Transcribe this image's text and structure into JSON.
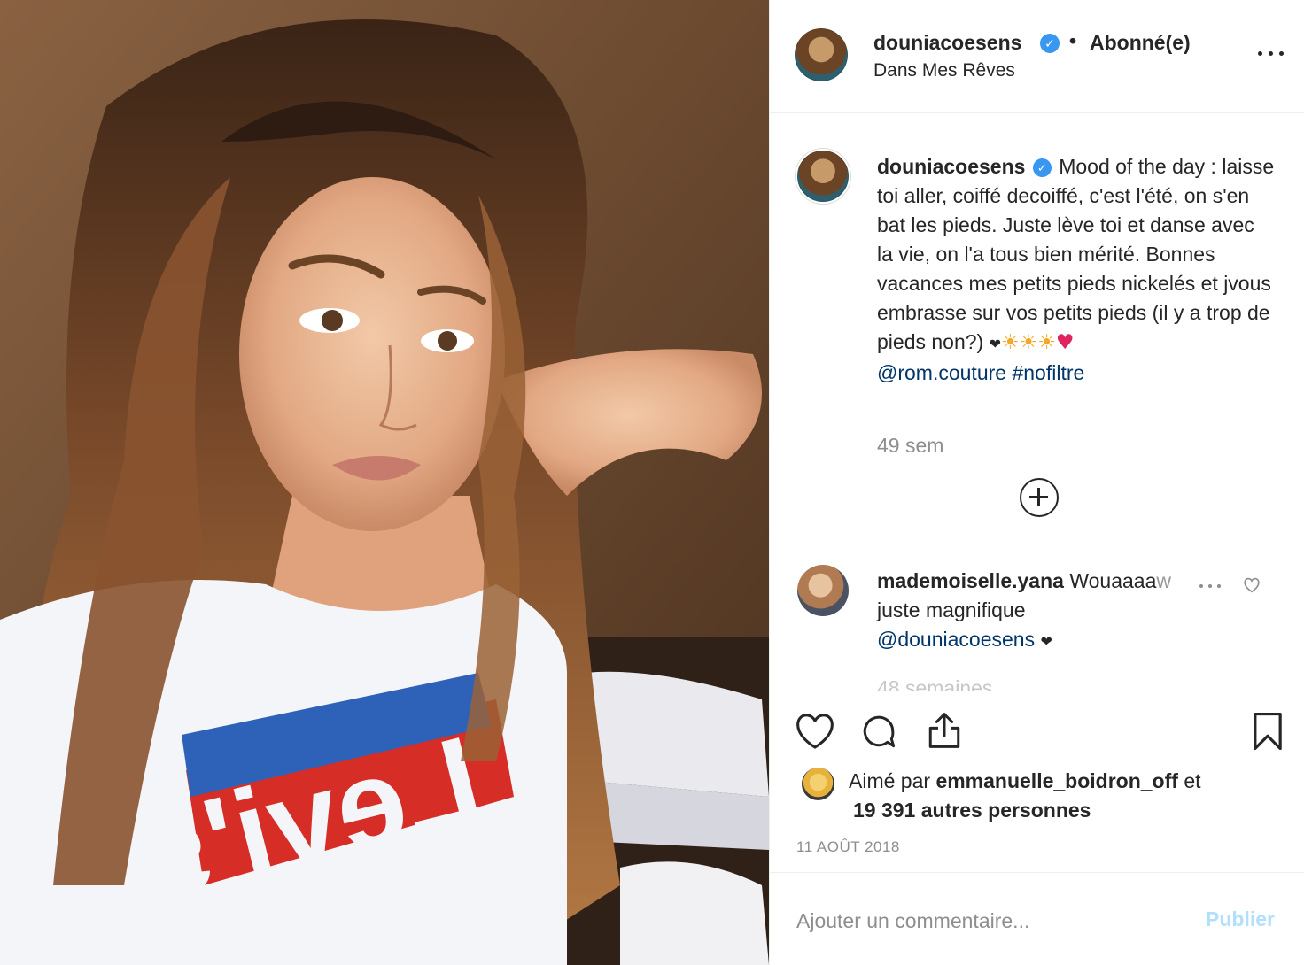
{
  "post": {
    "username": "douniacoesens",
    "verified_mark": "✓",
    "separator": "•",
    "follow_status": "Abonné(e)",
    "location": "Dans Mes Rêves"
  },
  "caption": {
    "username": "douniacoesens",
    "text": "Mood of the day : laisse toi aller, coiffé decoiffé, c'est l'été, on s'en bat les pieds. Juste lève toi et danse avec la vie, on l'a tous bien mérité. Bonnes vacances mes petits pieds nickelés et jvous embrasse sur vos petits pieds (il y a trop de pieds non?)",
    "emojis": [
      "❤",
      "☀",
      "☀",
      "☀",
      "♥"
    ],
    "mention": "@rom.couture",
    "hashtag": "#nofiltre",
    "time_ago": "49 sem"
  },
  "comments": [
    {
      "username": "mademoiselle.yana",
      "text_visible": "Wouaaaa",
      "text_faded": "w",
      "text_line2": "juste magnifique",
      "mention": "@douniacoesens",
      "heart": "❤"
    }
  ],
  "cut_off_text": "48 semaines",
  "likes": {
    "prefix": "Aimé par",
    "user": "emmanuelle_boidron_off",
    "suffix": "et",
    "count_text": "19 391 autres personnes"
  },
  "date": "11 AOÛT 2018",
  "comment_box": {
    "placeholder": "Ajouter un commentaire...",
    "publish_label": "Publier"
  },
  "icons": [
    "more-options-icon",
    "verified-icon",
    "add-circle-icon",
    "heart-icon",
    "comment-icon",
    "share-icon",
    "bookmark-icon"
  ],
  "colors": {
    "verified": "#3897f0",
    "link": "#003569",
    "secondary_text": "#8e8e8e",
    "publish_disabled": "#b2dffc"
  }
}
